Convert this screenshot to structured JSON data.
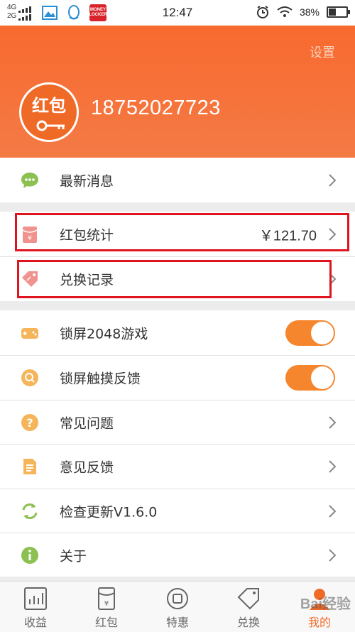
{
  "status_bar": {
    "network_1": "4G",
    "network_2": "2G",
    "time": "12:47",
    "battery": "38%",
    "battery_level": 0.38,
    "notification_app": "MONEY LOCKER"
  },
  "header": {
    "settings_label": "设置",
    "avatar_text": "红包",
    "phone": "18752027723",
    "bg_color": "#f86a2f"
  },
  "menu": {
    "messages": "最新消息",
    "redpacket_stats": "红包统计",
    "redpacket_amount": "￥121.70",
    "exchange_records": "兑换记录",
    "lock_2048": "锁屏2048游戏",
    "lock_2048_on": true,
    "lock_feedback": "锁屏触摸反馈",
    "lock_feedback_on": true,
    "faq": "常见问题",
    "feedback": "意见反馈",
    "check_update": "检查更新V1.6.0",
    "about": "关于"
  },
  "tabs": [
    {
      "label": "收益",
      "icon": "chart-icon"
    },
    {
      "label": "红包",
      "icon": "redpacket-icon"
    },
    {
      "label": "特惠",
      "icon": "deal-icon"
    },
    {
      "label": "兑换",
      "icon": "exchange-icon"
    },
    {
      "label": "我的",
      "icon": "profile-icon",
      "active": true
    }
  ],
  "watermark": "Bai经验",
  "accent_color": "#f5862e",
  "highlight_color": "#e0141e"
}
